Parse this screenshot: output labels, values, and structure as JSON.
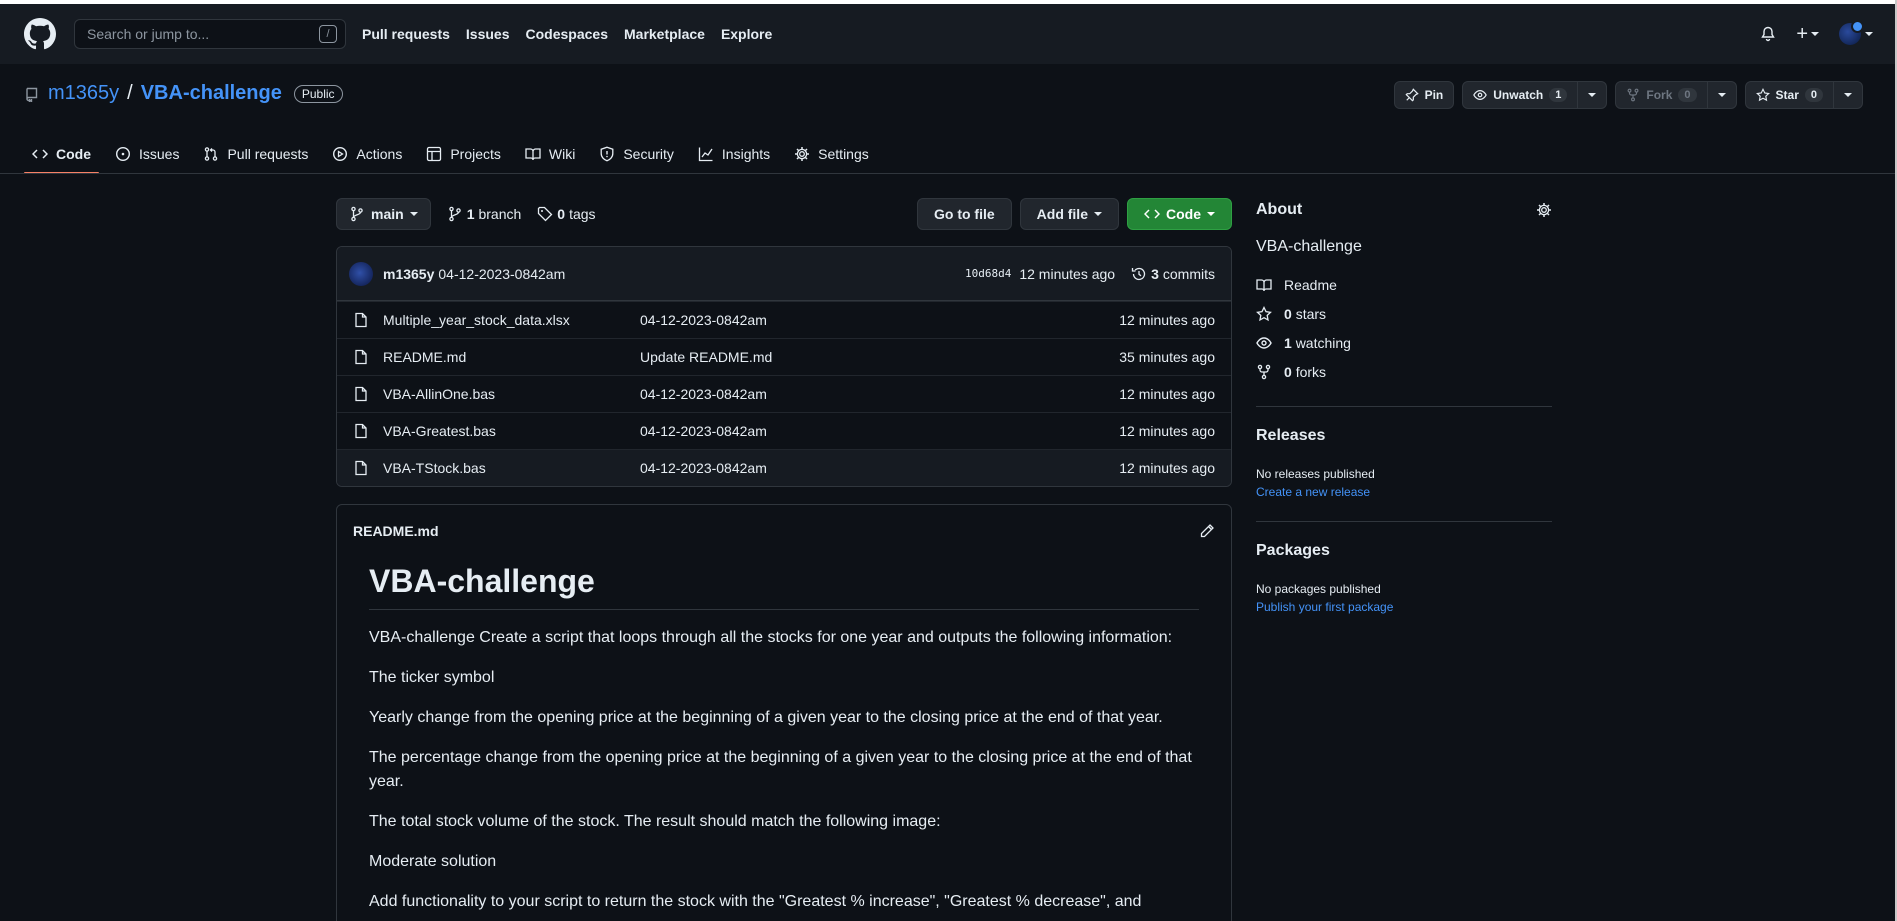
{
  "header": {
    "search_placeholder": "Search or jump to...",
    "search_shortcut": "/",
    "nav": [
      "Pull requests",
      "Issues",
      "Codespaces",
      "Marketplace",
      "Explore"
    ],
    "plus": "+"
  },
  "repo": {
    "owner": "m1365y",
    "separator": "/",
    "name": "VBA-challenge",
    "visibility": "Public",
    "pin_label": "Pin",
    "unwatch_label": "Unwatch",
    "watch_count": "1",
    "fork_label": "Fork",
    "fork_count": "0",
    "star_label": "Star",
    "star_count": "0"
  },
  "tabs": [
    {
      "label": "Code",
      "icon": "code-icon"
    },
    {
      "label": "Issues",
      "icon": "issue-icon"
    },
    {
      "label": "Pull requests",
      "icon": "pull-request-icon"
    },
    {
      "label": "Actions",
      "icon": "play-icon"
    },
    {
      "label": "Projects",
      "icon": "table-icon"
    },
    {
      "label": "Wiki",
      "icon": "book-icon"
    },
    {
      "label": "Security",
      "icon": "shield-icon"
    },
    {
      "label": "Insights",
      "icon": "graph-icon"
    },
    {
      "label": "Settings",
      "icon": "gear-icon"
    }
  ],
  "toolbar": {
    "branch": "main",
    "branch_count": "1",
    "branch_label": "branch",
    "tag_count": "0",
    "tag_label": "tags",
    "go_to_file": "Go to file",
    "add_file": "Add file",
    "code": "Code"
  },
  "commit": {
    "author": "m1365y",
    "message": "04-12-2023-0842am",
    "sha": "10d68d4",
    "time": "12 minutes ago",
    "count": "3",
    "count_label": "commits"
  },
  "files": [
    {
      "name": "Multiple_year_stock_data.xlsx",
      "message": "04-12-2023-0842am",
      "time": "12 minutes ago"
    },
    {
      "name": "README.md",
      "message": "Update README.md",
      "time": "35 minutes ago"
    },
    {
      "name": "VBA-AllinOne.bas",
      "message": "04-12-2023-0842am",
      "time": "12 minutes ago"
    },
    {
      "name": "VBA-Greatest.bas",
      "message": "04-12-2023-0842am",
      "time": "12 minutes ago"
    },
    {
      "name": "VBA-TStock.bas",
      "message": "04-12-2023-0842am",
      "time": "12 minutes ago"
    }
  ],
  "readme": {
    "filename": "README.md",
    "heading": "VBA-challenge",
    "paragraphs": [
      "VBA-challenge Create a script that loops through all the stocks for one year and outputs the following information:",
      "The ticker symbol",
      "Yearly change from the opening price at the beginning of a given year to the closing price at the end of that year.",
      "The percentage change from the opening price at the beginning of a given year to the closing price at the end of that year.",
      "The total stock volume of the stock. The result should match the following image:",
      "Moderate solution",
      "Add functionality to your script to return the stock with the \"Greatest % increase\", \"Greatest % decrease\", and"
    ]
  },
  "about": {
    "title": "About",
    "description": "VBA-challenge",
    "readme": "Readme",
    "stars_count": "0",
    "stars_label": "stars",
    "watching_count": "1",
    "watching_label": "watching",
    "forks_count": "0",
    "forks_label": "forks"
  },
  "releases": {
    "title": "Releases",
    "empty": "No releases published",
    "link": "Create a new release"
  },
  "packages": {
    "title": "Packages",
    "empty": "No packages published",
    "link": "Publish your first package"
  }
}
